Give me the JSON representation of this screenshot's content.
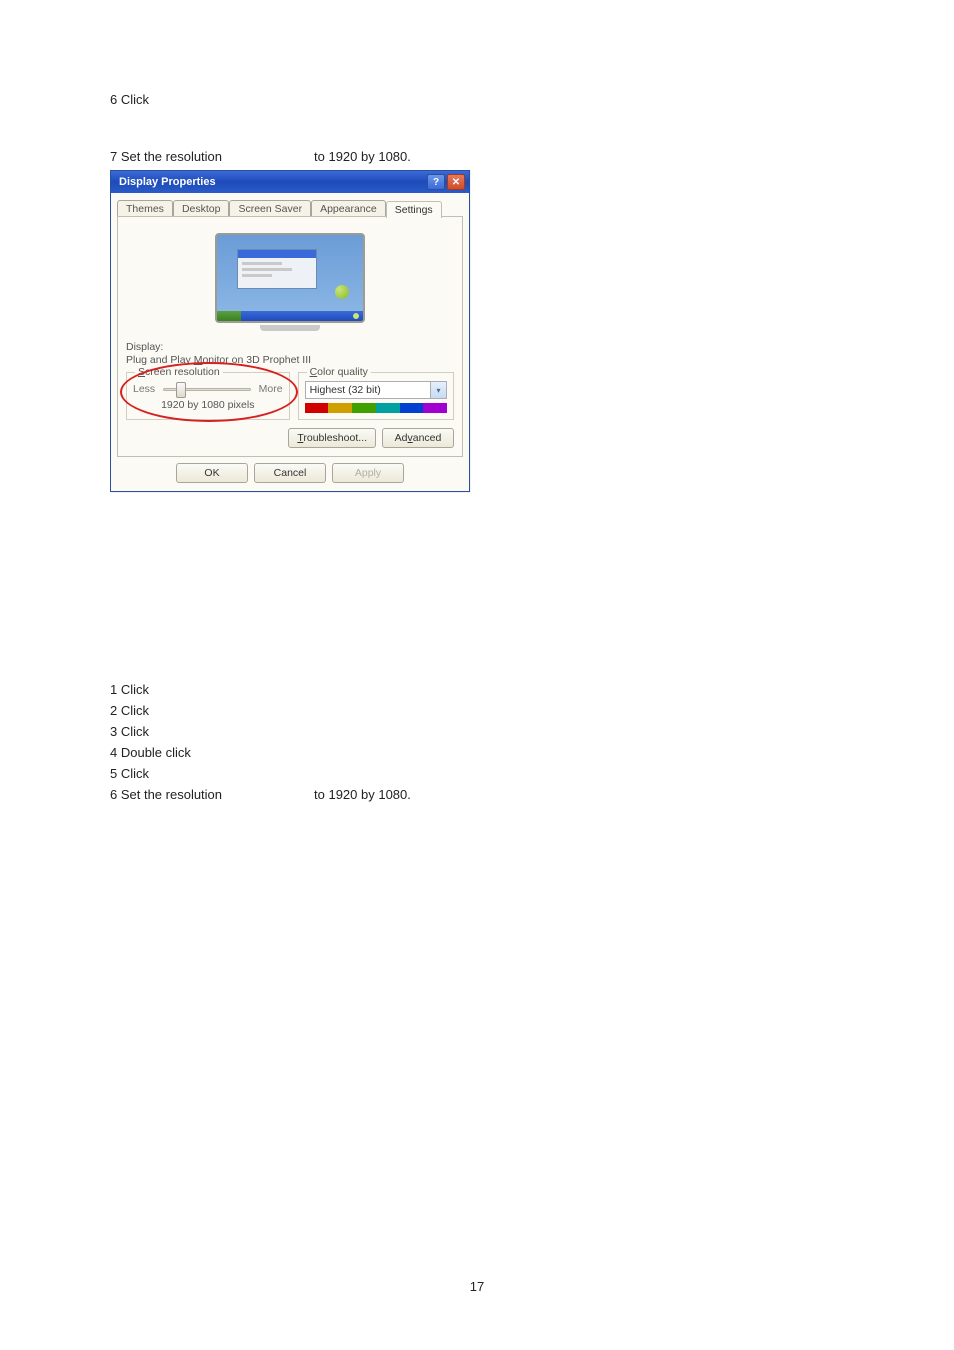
{
  "top": {
    "step6": "6 Click",
    "step7_left": "7 Set the resolution",
    "step7_right_prefix": "to ",
    "step7_right_value": "1920 by 1080."
  },
  "dialog": {
    "title": "Display Properties",
    "tabs": [
      "Themes",
      "Desktop",
      "Screen Saver",
      "Appearance",
      "Settings"
    ],
    "active_tab": 4,
    "display_label": "Display:",
    "display_text_pre": "Plug and Play ",
    "display_text_u": "M",
    "display_text_post": "onitor on 3D Prophet III",
    "screen_res": {
      "legend_pre": "",
      "legend_u": "S",
      "legend_post": "creen resolution",
      "less": "Less",
      "more": "More",
      "value": "1920 by 1080 pixels",
      "thumb_percent": 18
    },
    "color_quality": {
      "legend_pre": "",
      "legend_u": "C",
      "legend_post": "olor quality",
      "selected": "Highest (32 bit)"
    },
    "buttons": {
      "troubleshoot_pre": "",
      "troubleshoot_u": "T",
      "troubleshoot_post": "roubleshoot...",
      "advanced_pre": "Ad",
      "advanced_u": "v",
      "advanced_post": "anced"
    },
    "ok": "OK",
    "cancel": "Cancel",
    "apply": "Apply"
  },
  "bottom": {
    "lines": [
      "1 Click",
      "2 Click",
      "3 Click",
      "4 Double click",
      "5 Click"
    ],
    "step6_left": "6 Set the resolution",
    "step6_right_prefix": "to ",
    "step6_right_value": "1920 by 1080."
  },
  "page_number": "17"
}
